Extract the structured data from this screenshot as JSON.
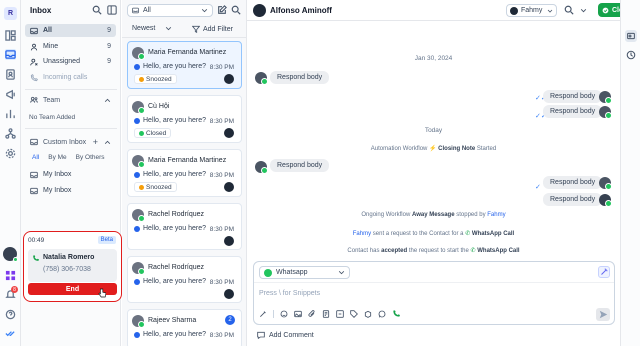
{
  "rail": {
    "avatar_letter": "R",
    "badge": "8"
  },
  "inbox": {
    "title": "Inbox",
    "items": [
      {
        "label": "All",
        "count": "9"
      },
      {
        "label": "Mine",
        "count": "9"
      },
      {
        "label": "Unassigned",
        "count": "9"
      },
      {
        "label": "Incoming calls"
      }
    ],
    "team_title": "Team",
    "no_team": "No Team Added",
    "custom_title": "Custom Inbox",
    "custom_tabs": [
      "All",
      "By Me",
      "By Others"
    ],
    "custom_items": [
      "My Inbox",
      "My Inbox"
    ]
  },
  "call": {
    "timer": "00:49",
    "beta": "Beta",
    "name": "Natalia Romero",
    "phone": "(758) 306-7038",
    "end": "End"
  },
  "list": {
    "filter": "All",
    "sort": "Newest",
    "add_filter": "Add Filter",
    "conversations": [
      {
        "name": "Maria Fernanda Martinez",
        "message": "Hello, are you here?",
        "time": "8:30 PM",
        "tag": "Snoozed",
        "tag_color": "#f59e0b"
      },
      {
        "name": "Cù Hội",
        "message": "Hello, are you here?",
        "time": "8:30 PM",
        "tag": "Closed",
        "tag_color": "#22c55e"
      },
      {
        "name": "Maria Fernanda Martinez",
        "message": "Hello, are you here?",
        "time": "8:30 PM",
        "tag": "Snoozed",
        "tag_color": "#f59e0b"
      },
      {
        "name": "Rachel Rodríquez",
        "message": "Hello, are you here?",
        "time": "8:30 PM"
      },
      {
        "name": "Rachel Rodríquez",
        "message": "Hello, are you here?",
        "time": "8:30 PM"
      },
      {
        "name": "Rajeev Sharma",
        "message": "Hello, are you here?",
        "time": "8:30 PM",
        "unread": "2"
      }
    ]
  },
  "chat": {
    "contact_name": "Alfonso Aminoff",
    "agent": "Fahmy",
    "close_label": "Close",
    "date1": "Jan 30, 2024",
    "date2": "Today",
    "bubble": "Respond body",
    "sys1": {
      "pre": "Automation Workflow",
      "name": "Closing Note",
      "post": "Started"
    },
    "sys2": {
      "pre": "Ongoing Workflow",
      "name": "Away Message",
      "mid": "stopped by",
      "who": "Fahmy"
    },
    "sys3": {
      "who": "Fahmy",
      "mid": "sent a request to the Contact for a",
      "channel": "WhatsApp Call"
    },
    "sys4": {
      "pre": "Contact has",
      "bold": "accepted",
      "mid": "the request to start the",
      "channel": "WhatsApp Call"
    },
    "channel_select": "Whatsapp",
    "composer_placeholder": "Press \\ for Snippets",
    "add_comment": "Add Comment"
  },
  "colors": {
    "accent": "#2563eb",
    "close_green": "#16a34a",
    "danger": "#e11d1d",
    "whatsapp": "#22c55e"
  }
}
